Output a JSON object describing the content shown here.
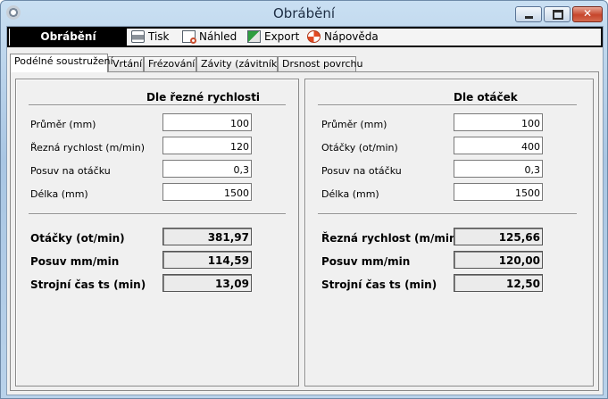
{
  "window": {
    "title": "Obrábění"
  },
  "toolbar": {
    "module": "Obrábění",
    "print": "Tisk",
    "preview": "Náhled",
    "export": "Export",
    "help": "Nápověda"
  },
  "tabs": [
    {
      "label": "Podélné soustružení",
      "active": true
    },
    {
      "label": "Vrtání",
      "active": false
    },
    {
      "label": "Frézování",
      "active": false
    },
    {
      "label": "Závity (závitník)",
      "active": false
    },
    {
      "label": "Drsnost povrchu",
      "active": false
    }
  ],
  "left": {
    "title": "Dle řezné rychlosti",
    "inputs": [
      {
        "label": "Průměr (mm)",
        "value": "100"
      },
      {
        "label": "Řezná rychlost (m/min)",
        "value": "120"
      },
      {
        "label": "Posuv na otáčku",
        "value": "0,3"
      },
      {
        "label": "Délka (mm)",
        "value": "1500"
      }
    ],
    "outputs": [
      {
        "label": "Otáčky (ot/min)",
        "value": "381,97"
      },
      {
        "label": "Posuv mm/min",
        "value": "114,59"
      },
      {
        "label": "Strojní čas ts (min)",
        "value": "13,09"
      }
    ]
  },
  "right": {
    "title": "Dle otáček",
    "inputs": [
      {
        "label": "Průměr (mm)",
        "value": "100"
      },
      {
        "label": "Otáčky (ot/min)",
        "value": "400"
      },
      {
        "label": "Posuv na otáčku",
        "value": "0,3"
      },
      {
        "label": "Délka (mm)",
        "value": "1500"
      }
    ],
    "outputs": [
      {
        "label": "Řezná rychlost (m/min)",
        "value": "125,66"
      },
      {
        "label": "Posuv mm/min",
        "value": "120,00"
      },
      {
        "label": "Strojní čas ts (min)",
        "value": "12,50"
      }
    ]
  }
}
